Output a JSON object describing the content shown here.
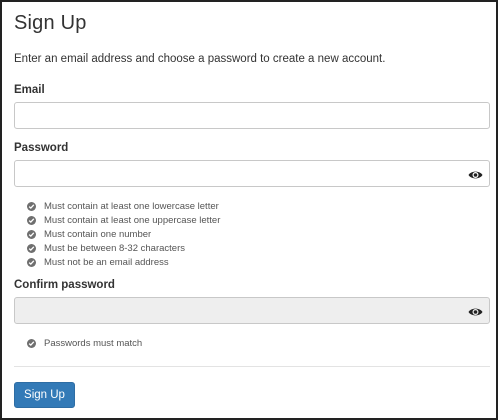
{
  "form": {
    "title": "Sign Up",
    "intro": "Enter an email address and choose a password to create a new account.",
    "email": {
      "label": "Email",
      "value": "",
      "placeholder": ""
    },
    "password": {
      "label": "Password",
      "value": "",
      "placeholder": "",
      "toggle_icon": "eye-icon",
      "rules": [
        "Must contain at least one lowercase letter",
        "Must contain at least one uppercase letter",
        "Must contain one number",
        "Must be between 8-32 characters",
        "Must not be an email address"
      ]
    },
    "confirm": {
      "label": "Confirm password",
      "value": "",
      "placeholder": "",
      "toggle_icon": "eye-icon",
      "rules": [
        "Passwords must match"
      ]
    },
    "submit_label": "Sign Up"
  },
  "colors": {
    "primary_button": "#337ab7",
    "disabled_input": "#eeeeee",
    "rule_icon": "#6f6f6f"
  }
}
